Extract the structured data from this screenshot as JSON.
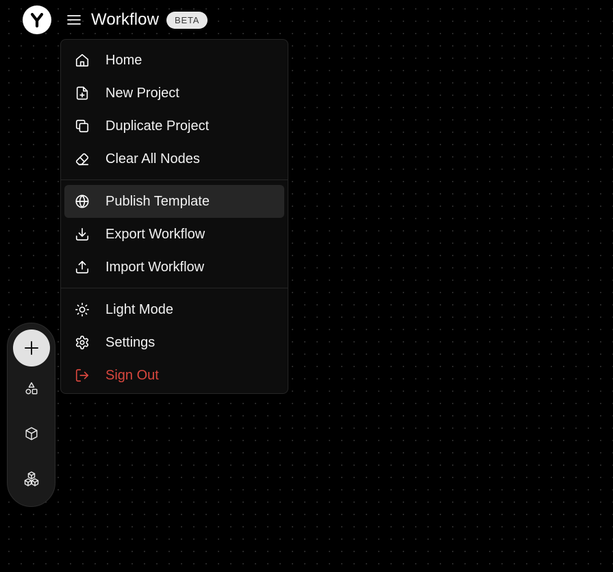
{
  "header": {
    "title": "Workflow",
    "badge": "BETA",
    "logo_icon": "y-logo-icon",
    "menu_icon": "hamburger-icon"
  },
  "menu": {
    "sections": [
      {
        "items": [
          {
            "label": "Home",
            "icon": "home-icon"
          },
          {
            "label": "New Project",
            "icon": "file-plus-icon"
          },
          {
            "label": "Duplicate Project",
            "icon": "copy-icon"
          },
          {
            "label": "Clear All Nodes",
            "icon": "eraser-icon"
          }
        ]
      },
      {
        "items": [
          {
            "label": "Publish Template",
            "icon": "globe-icon",
            "active": true
          },
          {
            "label": "Export Workflow",
            "icon": "download-icon"
          },
          {
            "label": "Import Workflow",
            "icon": "upload-icon"
          }
        ]
      },
      {
        "items": [
          {
            "label": "Light Mode",
            "icon": "sun-icon"
          },
          {
            "label": "Settings",
            "icon": "gear-icon"
          },
          {
            "label": "Sign Out",
            "icon": "sign-out-icon",
            "danger": true
          }
        ]
      }
    ]
  },
  "toolbar": {
    "buttons": [
      {
        "icon": "plus-icon"
      },
      {
        "icon": "shapes-icon"
      },
      {
        "icon": "box-icon"
      },
      {
        "icon": "boxes-icon"
      }
    ]
  },
  "colors": {
    "background": "#000000",
    "menu_bg": "#0d0d0d",
    "active_item": "#262626",
    "danger": "#d9473e",
    "badge_bg": "#e8e8e8"
  }
}
